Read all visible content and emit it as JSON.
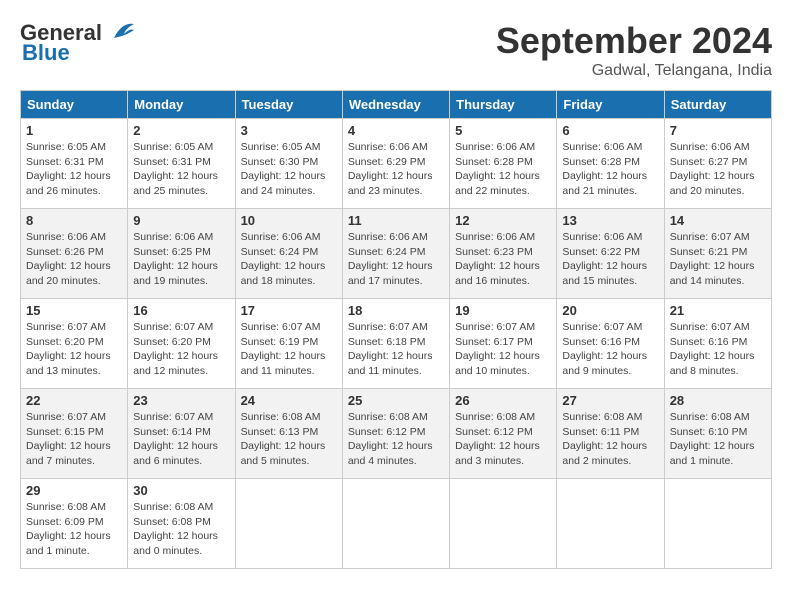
{
  "logo": {
    "line1": "General",
    "line2": "Blue"
  },
  "title": "September 2024",
  "subtitle": "Gadwal, Telangana, India",
  "days_of_week": [
    "Sunday",
    "Monday",
    "Tuesday",
    "Wednesday",
    "Thursday",
    "Friday",
    "Saturday"
  ],
  "weeks": [
    [
      {
        "day": "1",
        "detail": "Sunrise: 6:05 AM\nSunset: 6:31 PM\nDaylight: 12 hours\nand 26 minutes."
      },
      {
        "day": "2",
        "detail": "Sunrise: 6:05 AM\nSunset: 6:31 PM\nDaylight: 12 hours\nand 25 minutes."
      },
      {
        "day": "3",
        "detail": "Sunrise: 6:05 AM\nSunset: 6:30 PM\nDaylight: 12 hours\nand 24 minutes."
      },
      {
        "day": "4",
        "detail": "Sunrise: 6:06 AM\nSunset: 6:29 PM\nDaylight: 12 hours\nand 23 minutes."
      },
      {
        "day": "5",
        "detail": "Sunrise: 6:06 AM\nSunset: 6:28 PM\nDaylight: 12 hours\nand 22 minutes."
      },
      {
        "day": "6",
        "detail": "Sunrise: 6:06 AM\nSunset: 6:28 PM\nDaylight: 12 hours\nand 21 minutes."
      },
      {
        "day": "7",
        "detail": "Sunrise: 6:06 AM\nSunset: 6:27 PM\nDaylight: 12 hours\nand 20 minutes."
      }
    ],
    [
      {
        "day": "8",
        "detail": "Sunrise: 6:06 AM\nSunset: 6:26 PM\nDaylight: 12 hours\nand 20 minutes."
      },
      {
        "day": "9",
        "detail": "Sunrise: 6:06 AM\nSunset: 6:25 PM\nDaylight: 12 hours\nand 19 minutes."
      },
      {
        "day": "10",
        "detail": "Sunrise: 6:06 AM\nSunset: 6:24 PM\nDaylight: 12 hours\nand 18 minutes."
      },
      {
        "day": "11",
        "detail": "Sunrise: 6:06 AM\nSunset: 6:24 PM\nDaylight: 12 hours\nand 17 minutes."
      },
      {
        "day": "12",
        "detail": "Sunrise: 6:06 AM\nSunset: 6:23 PM\nDaylight: 12 hours\nand 16 minutes."
      },
      {
        "day": "13",
        "detail": "Sunrise: 6:06 AM\nSunset: 6:22 PM\nDaylight: 12 hours\nand 15 minutes."
      },
      {
        "day": "14",
        "detail": "Sunrise: 6:07 AM\nSunset: 6:21 PM\nDaylight: 12 hours\nand 14 minutes."
      }
    ],
    [
      {
        "day": "15",
        "detail": "Sunrise: 6:07 AM\nSunset: 6:20 PM\nDaylight: 12 hours\nand 13 minutes."
      },
      {
        "day": "16",
        "detail": "Sunrise: 6:07 AM\nSunset: 6:20 PM\nDaylight: 12 hours\nand 12 minutes."
      },
      {
        "day": "17",
        "detail": "Sunrise: 6:07 AM\nSunset: 6:19 PM\nDaylight: 12 hours\nand 11 minutes."
      },
      {
        "day": "18",
        "detail": "Sunrise: 6:07 AM\nSunset: 6:18 PM\nDaylight: 12 hours\nand 11 minutes."
      },
      {
        "day": "19",
        "detail": "Sunrise: 6:07 AM\nSunset: 6:17 PM\nDaylight: 12 hours\nand 10 minutes."
      },
      {
        "day": "20",
        "detail": "Sunrise: 6:07 AM\nSunset: 6:16 PM\nDaylight: 12 hours\nand 9 minutes."
      },
      {
        "day": "21",
        "detail": "Sunrise: 6:07 AM\nSunset: 6:16 PM\nDaylight: 12 hours\nand 8 minutes."
      }
    ],
    [
      {
        "day": "22",
        "detail": "Sunrise: 6:07 AM\nSunset: 6:15 PM\nDaylight: 12 hours\nand 7 minutes."
      },
      {
        "day": "23",
        "detail": "Sunrise: 6:07 AM\nSunset: 6:14 PM\nDaylight: 12 hours\nand 6 minutes."
      },
      {
        "day": "24",
        "detail": "Sunrise: 6:08 AM\nSunset: 6:13 PM\nDaylight: 12 hours\nand 5 minutes."
      },
      {
        "day": "25",
        "detail": "Sunrise: 6:08 AM\nSunset: 6:12 PM\nDaylight: 12 hours\nand 4 minutes."
      },
      {
        "day": "26",
        "detail": "Sunrise: 6:08 AM\nSunset: 6:12 PM\nDaylight: 12 hours\nand 3 minutes."
      },
      {
        "day": "27",
        "detail": "Sunrise: 6:08 AM\nSunset: 6:11 PM\nDaylight: 12 hours\nand 2 minutes."
      },
      {
        "day": "28",
        "detail": "Sunrise: 6:08 AM\nSunset: 6:10 PM\nDaylight: 12 hours\nand 1 minute."
      }
    ],
    [
      {
        "day": "29",
        "detail": "Sunrise: 6:08 AM\nSunset: 6:09 PM\nDaylight: 12 hours\nand 1 minute."
      },
      {
        "day": "30",
        "detail": "Sunrise: 6:08 AM\nSunset: 6:08 PM\nDaylight: 12 hours\nand 0 minutes."
      },
      {
        "day": "",
        "detail": ""
      },
      {
        "day": "",
        "detail": ""
      },
      {
        "day": "",
        "detail": ""
      },
      {
        "day": "",
        "detail": ""
      },
      {
        "day": "",
        "detail": ""
      }
    ]
  ]
}
